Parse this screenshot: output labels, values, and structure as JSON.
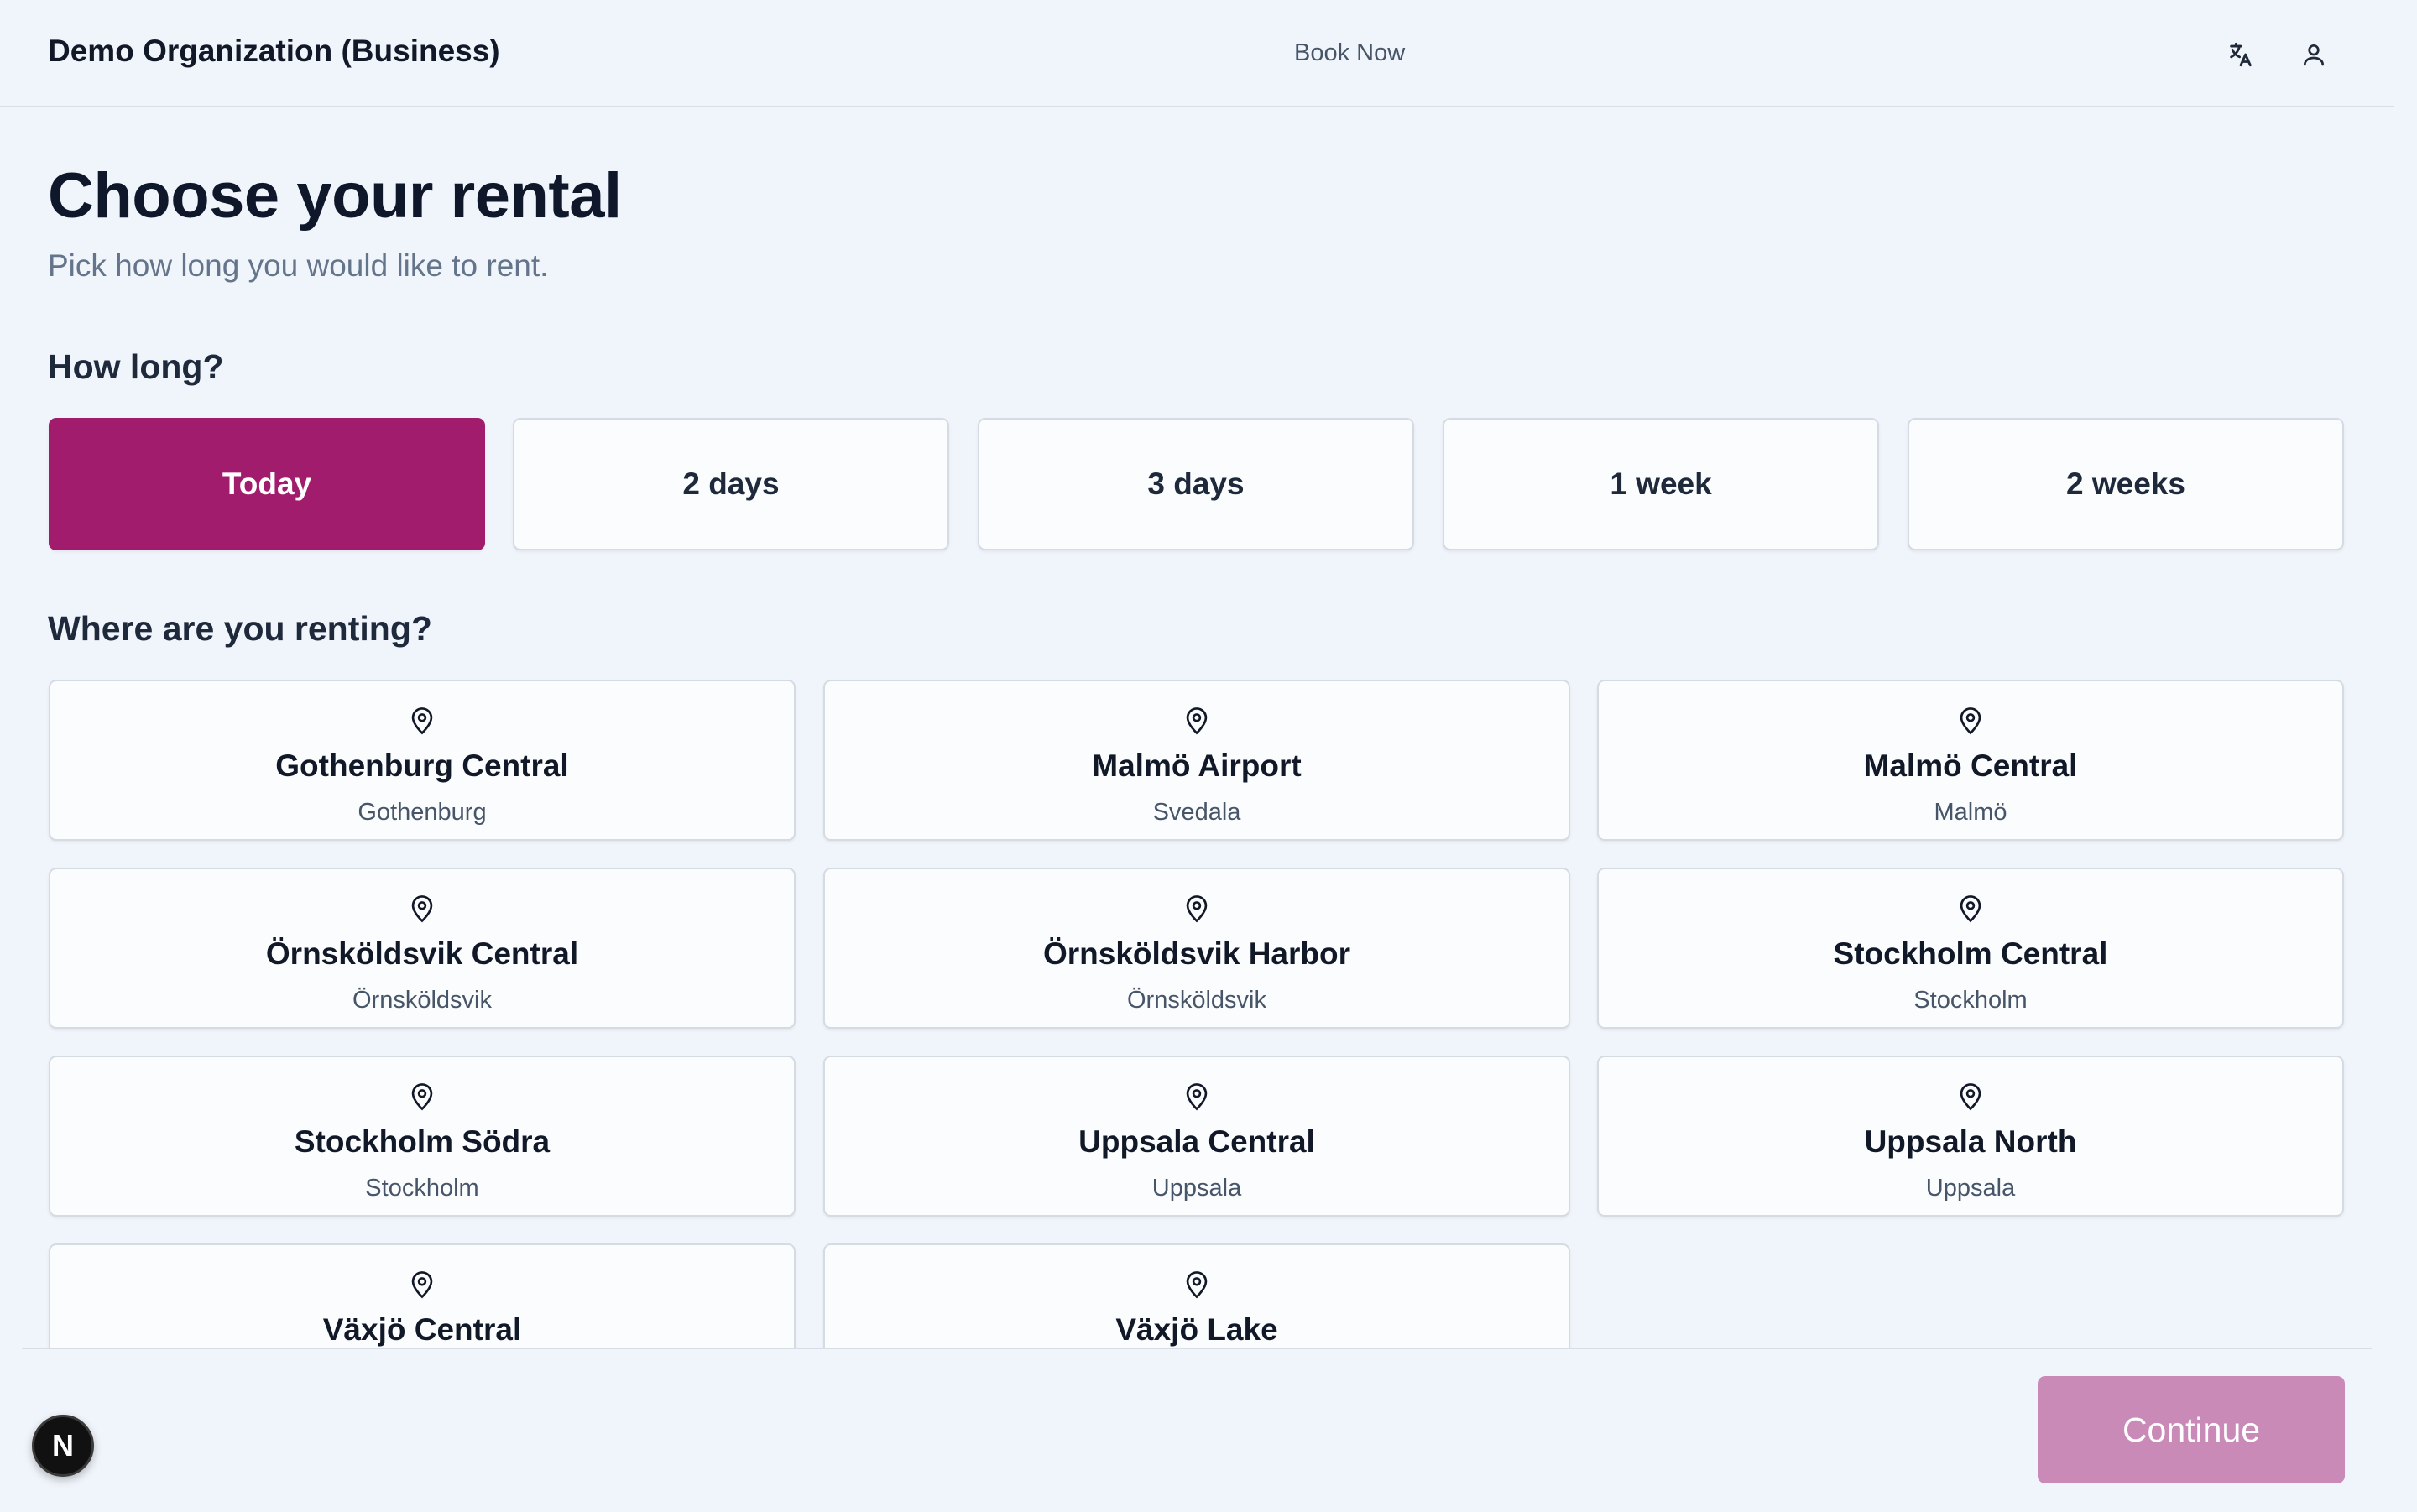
{
  "header": {
    "org_name": "Demo Organization (Business)",
    "nav_link": "Book Now",
    "icons": [
      "translate-icon",
      "user-icon"
    ]
  },
  "main": {
    "title": "Choose your rental",
    "subtitle": "Pick how long you would like to rent.",
    "duration_label": "How long?",
    "durations": [
      {
        "label": "Today",
        "selected": true
      },
      {
        "label": "2 days",
        "selected": false
      },
      {
        "label": "3 days",
        "selected": false
      },
      {
        "label": "1 week",
        "selected": false
      },
      {
        "label": "2 weeks",
        "selected": false
      }
    ],
    "location_label": "Where are you renting?",
    "locations": [
      {
        "name": "Gothenburg Central",
        "city": "Gothenburg"
      },
      {
        "name": "Malmö Airport",
        "city": "Svedala"
      },
      {
        "name": "Malmö Central",
        "city": "Malmö"
      },
      {
        "name": "Örnsköldsvik Central",
        "city": "Örnsköldsvik"
      },
      {
        "name": "Örnsköldsvik Harbor",
        "city": "Örnsköldsvik"
      },
      {
        "name": "Stockholm Central",
        "city": "Stockholm"
      },
      {
        "name": "Stockholm Södra",
        "city": "Stockholm"
      },
      {
        "name": "Uppsala Central",
        "city": "Uppsala"
      },
      {
        "name": "Uppsala North",
        "city": "Uppsala"
      },
      {
        "name": "Växjö Central",
        "city": ""
      },
      {
        "name": "Växjö Lake",
        "city": ""
      }
    ]
  },
  "footer": {
    "continue_label": "Continue",
    "badge_letter": "N"
  },
  "colors": {
    "accent": "#a21c6e",
    "accent_disabled": "#c98ab8",
    "background": "#f0f5fb"
  }
}
